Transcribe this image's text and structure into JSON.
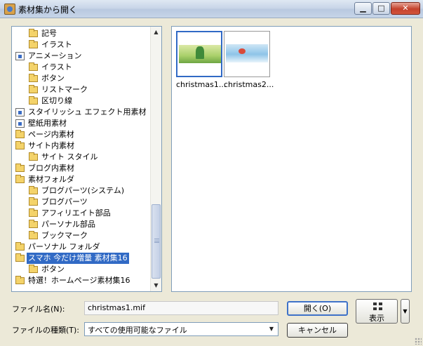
{
  "window": {
    "title": "素材集から開く",
    "minimize_glyph": "▁",
    "maximize_glyph": "□",
    "close_glyph": "✕"
  },
  "tree": {
    "items": [
      {
        "label": "記号",
        "level": 1,
        "icon": "folder-icon"
      },
      {
        "label": "イラスト",
        "level": 1,
        "icon": "folder-icon"
      },
      {
        "label": "アニメーション",
        "level": 0,
        "icon": "special-folder-icon"
      },
      {
        "label": "イラスト",
        "level": 1,
        "icon": "folder-icon"
      },
      {
        "label": "ボタン",
        "level": 1,
        "icon": "folder-icon"
      },
      {
        "label": "リストマーク",
        "level": 1,
        "icon": "folder-icon"
      },
      {
        "label": "区切り線",
        "level": 1,
        "icon": "folder-icon"
      },
      {
        "label": "スタイリッシュ エフェクト用素材",
        "level": 0,
        "icon": "special-folder-icon"
      },
      {
        "label": "壁紙用素材",
        "level": 0,
        "icon": "special-folder-icon"
      },
      {
        "label": "ページ内素材",
        "level": 0,
        "icon": "folder-icon"
      },
      {
        "label": "サイト内素材",
        "level": 0,
        "icon": "folder-icon"
      },
      {
        "label": "サイト スタイル",
        "level": 1,
        "icon": "folder-icon"
      },
      {
        "label": "ブログ内素材",
        "level": 0,
        "icon": "folder-icon"
      },
      {
        "label": "素材フォルダ",
        "level": 0,
        "icon": "folder-icon"
      },
      {
        "label": "ブログパーツ(システム)",
        "level": 1,
        "icon": "folder-icon"
      },
      {
        "label": "ブログパーツ",
        "level": 1,
        "icon": "folder-icon"
      },
      {
        "label": "アフィリエイト部品",
        "level": 1,
        "icon": "folder-icon"
      },
      {
        "label": "パーソナル部品",
        "level": 1,
        "icon": "folder-icon"
      },
      {
        "label": "ブックマーク",
        "level": 1,
        "icon": "folder-icon"
      },
      {
        "label": "パーソナル フォルダ",
        "level": 0,
        "icon": "personal-folder-icon"
      },
      {
        "label": "スマホ 今だけ増量 素材集16",
        "level": 0,
        "icon": "open-folder-icon",
        "selected": true
      },
      {
        "label": "ボタン",
        "level": 1,
        "icon": "folder-icon"
      },
      {
        "label": "特選！ホームページ素材集16",
        "level": 0,
        "icon": "folder-icon"
      }
    ],
    "scroll_up": "▲",
    "scroll_down": "▼"
  },
  "files": [
    {
      "label": "christmas1...",
      "selected": true
    },
    {
      "label": "christmas2..."
    }
  ],
  "form": {
    "filename_label": "ファイル名(N):",
    "filename_value": "christmas1.mif",
    "filetype_label": "ファイルの種類(T):",
    "filetype_value": "すべての使用可能なファイル",
    "dropdown_glyph": "▼"
  },
  "buttons": {
    "open": "開く(O)",
    "cancel": "キャンセル",
    "view": "表示",
    "view_dropdown": "▼"
  }
}
